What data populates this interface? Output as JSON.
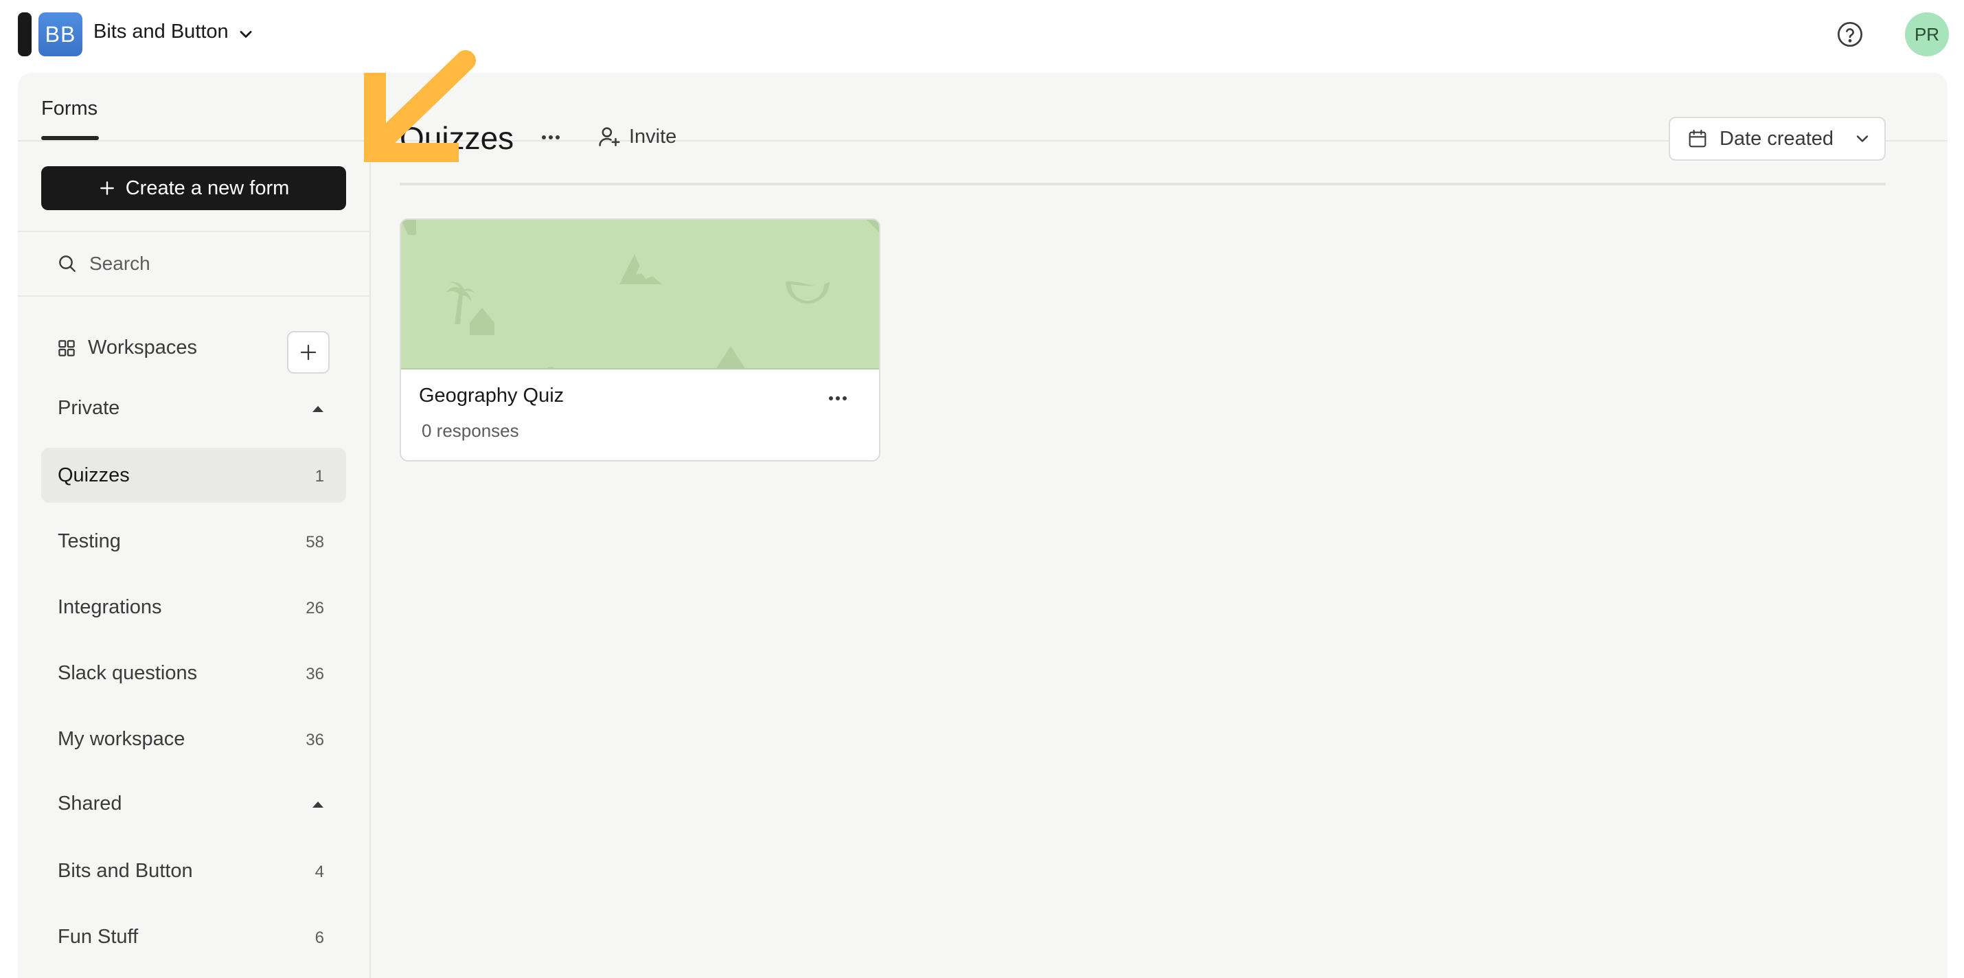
{
  "header": {
    "org_initials": "BB",
    "org_name": "Bits and Button",
    "user_initials": "PR"
  },
  "tabs": [
    {
      "label": "Forms",
      "active": true
    }
  ],
  "sidebar": {
    "create_label": "Create a new form",
    "search_label": "Search",
    "workspaces_label": "Workspaces",
    "private": {
      "label": "Private",
      "items": [
        {
          "label": "Quizzes",
          "count": "1",
          "active": true
        },
        {
          "label": "Testing",
          "count": "58"
        },
        {
          "label": "Integrations",
          "count": "26"
        },
        {
          "label": "Slack questions",
          "count": "36"
        },
        {
          "label": "My workspace",
          "count": "36"
        }
      ]
    },
    "shared": {
      "label": "Shared",
      "items": [
        {
          "label": "Bits and Button",
          "count": "4"
        },
        {
          "label": "Fun Stuff",
          "count": "6"
        }
      ]
    }
  },
  "main": {
    "title": "Quizzes",
    "invite_label": "Invite",
    "sort_label": "Date created",
    "forms": [
      {
        "title": "Geography Quiz",
        "responses": "0 responses"
      }
    ]
  },
  "colors": {
    "primary_button": "#191919",
    "card_cover": "#c5dfb2",
    "user_avatar": "#a7e3bb",
    "org_avatar": "#3a73c9",
    "annotation": "#ffb840"
  }
}
